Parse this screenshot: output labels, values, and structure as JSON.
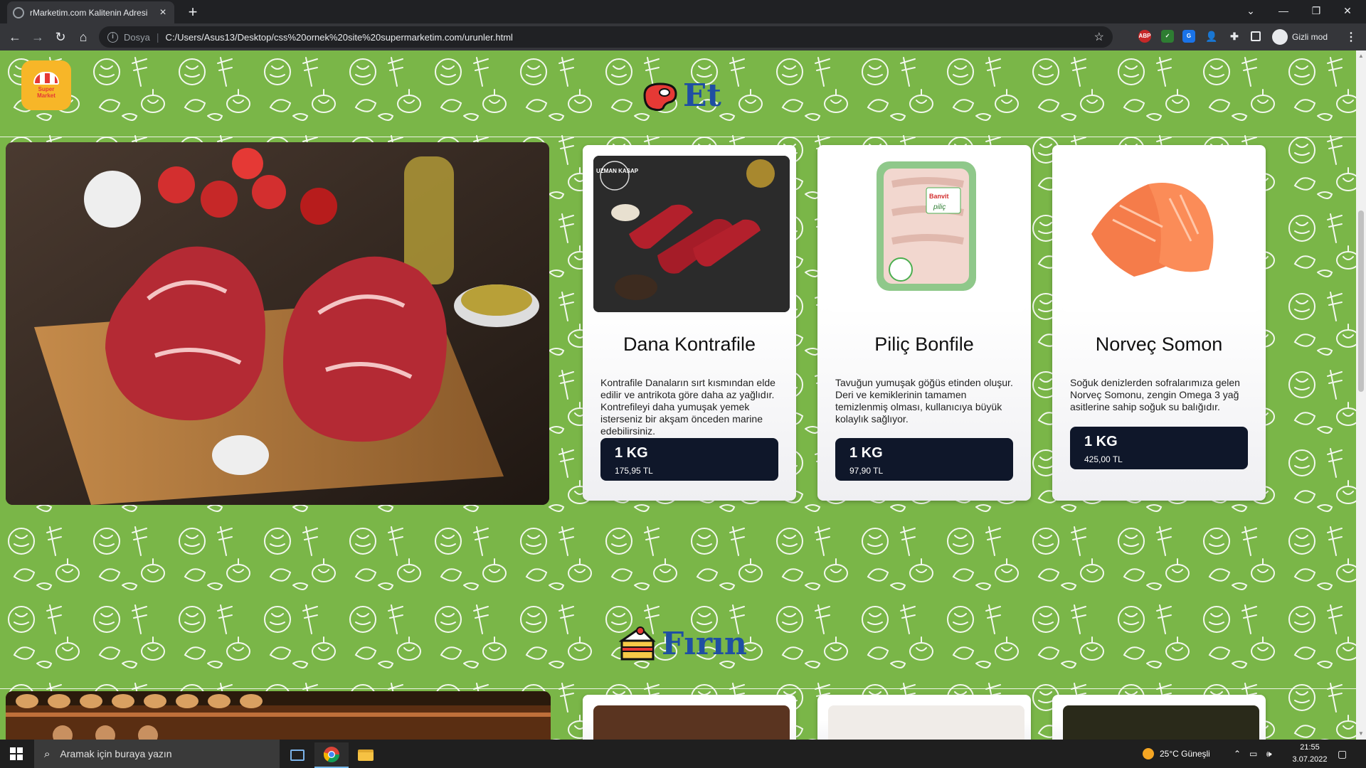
{
  "browser": {
    "tab_title": "rMarketim.com Kalitenin Adresi",
    "new_tab_label": "+",
    "url_scheme": "Dosya",
    "url": "C:/Users/Asus13/Desktop/css%20ornek%20site%20supermarketim.com/urunler.html",
    "profile_label": "Gizli mod",
    "extensions": [
      "abp-icon",
      "shield-icon",
      "translate-icon",
      "user-icon",
      "puzzle-icon",
      "sidepanel-icon"
    ],
    "window_controls": [
      "minimize",
      "restore",
      "close"
    ]
  },
  "site": {
    "logo_text_line1": "Super",
    "logo_text_line2": "Market",
    "sections": [
      {
        "title": "Et",
        "icon": "meat-icon",
        "products": [
          {
            "name": "Dana Kontrafile",
            "description": "Kontrafile Danaların sırt kısmından elde edilir ve antrikota göre daha az yağlıdır. Kontrefileyi daha yumuşak yemek isterseniz bir akşam önceden marine edebilirsiniz.",
            "unit": "1 KG",
            "price": "175,95 TL",
            "image_text": "UZMAN KASAP"
          },
          {
            "name": "Piliç Bonfile",
            "description": "Tavuğun yumuşak göğüs etinden oluşur. Deri ve kemiklerinin tamamen temizlenmiş olması, kullanıcıya büyük kolaylık sağlıyor.",
            "unit": "1 KG",
            "price": "97,90 TL",
            "image_text": "Banvit piliç"
          },
          {
            "name": "Norveç Somon",
            "description": "Soğuk denizlerden sofralarımıza gelen Norveç Somonu, zengin Omega 3 yağ asitlerine sahip soğuk su balığıdır.",
            "unit": "1 KG",
            "price": "425,00 TL"
          }
        ]
      },
      {
        "title": "Fırın",
        "icon": "cake-icon"
      }
    ]
  },
  "taskbar": {
    "search_placeholder": "Aramak için buraya yazın",
    "weather": "25°C  Güneşli",
    "time": "21:55",
    "date": "3.07.2022"
  },
  "colors": {
    "background_green": "#7ab648",
    "section_title_blue": "#1f4fa3",
    "price_box": "#0f172a"
  }
}
